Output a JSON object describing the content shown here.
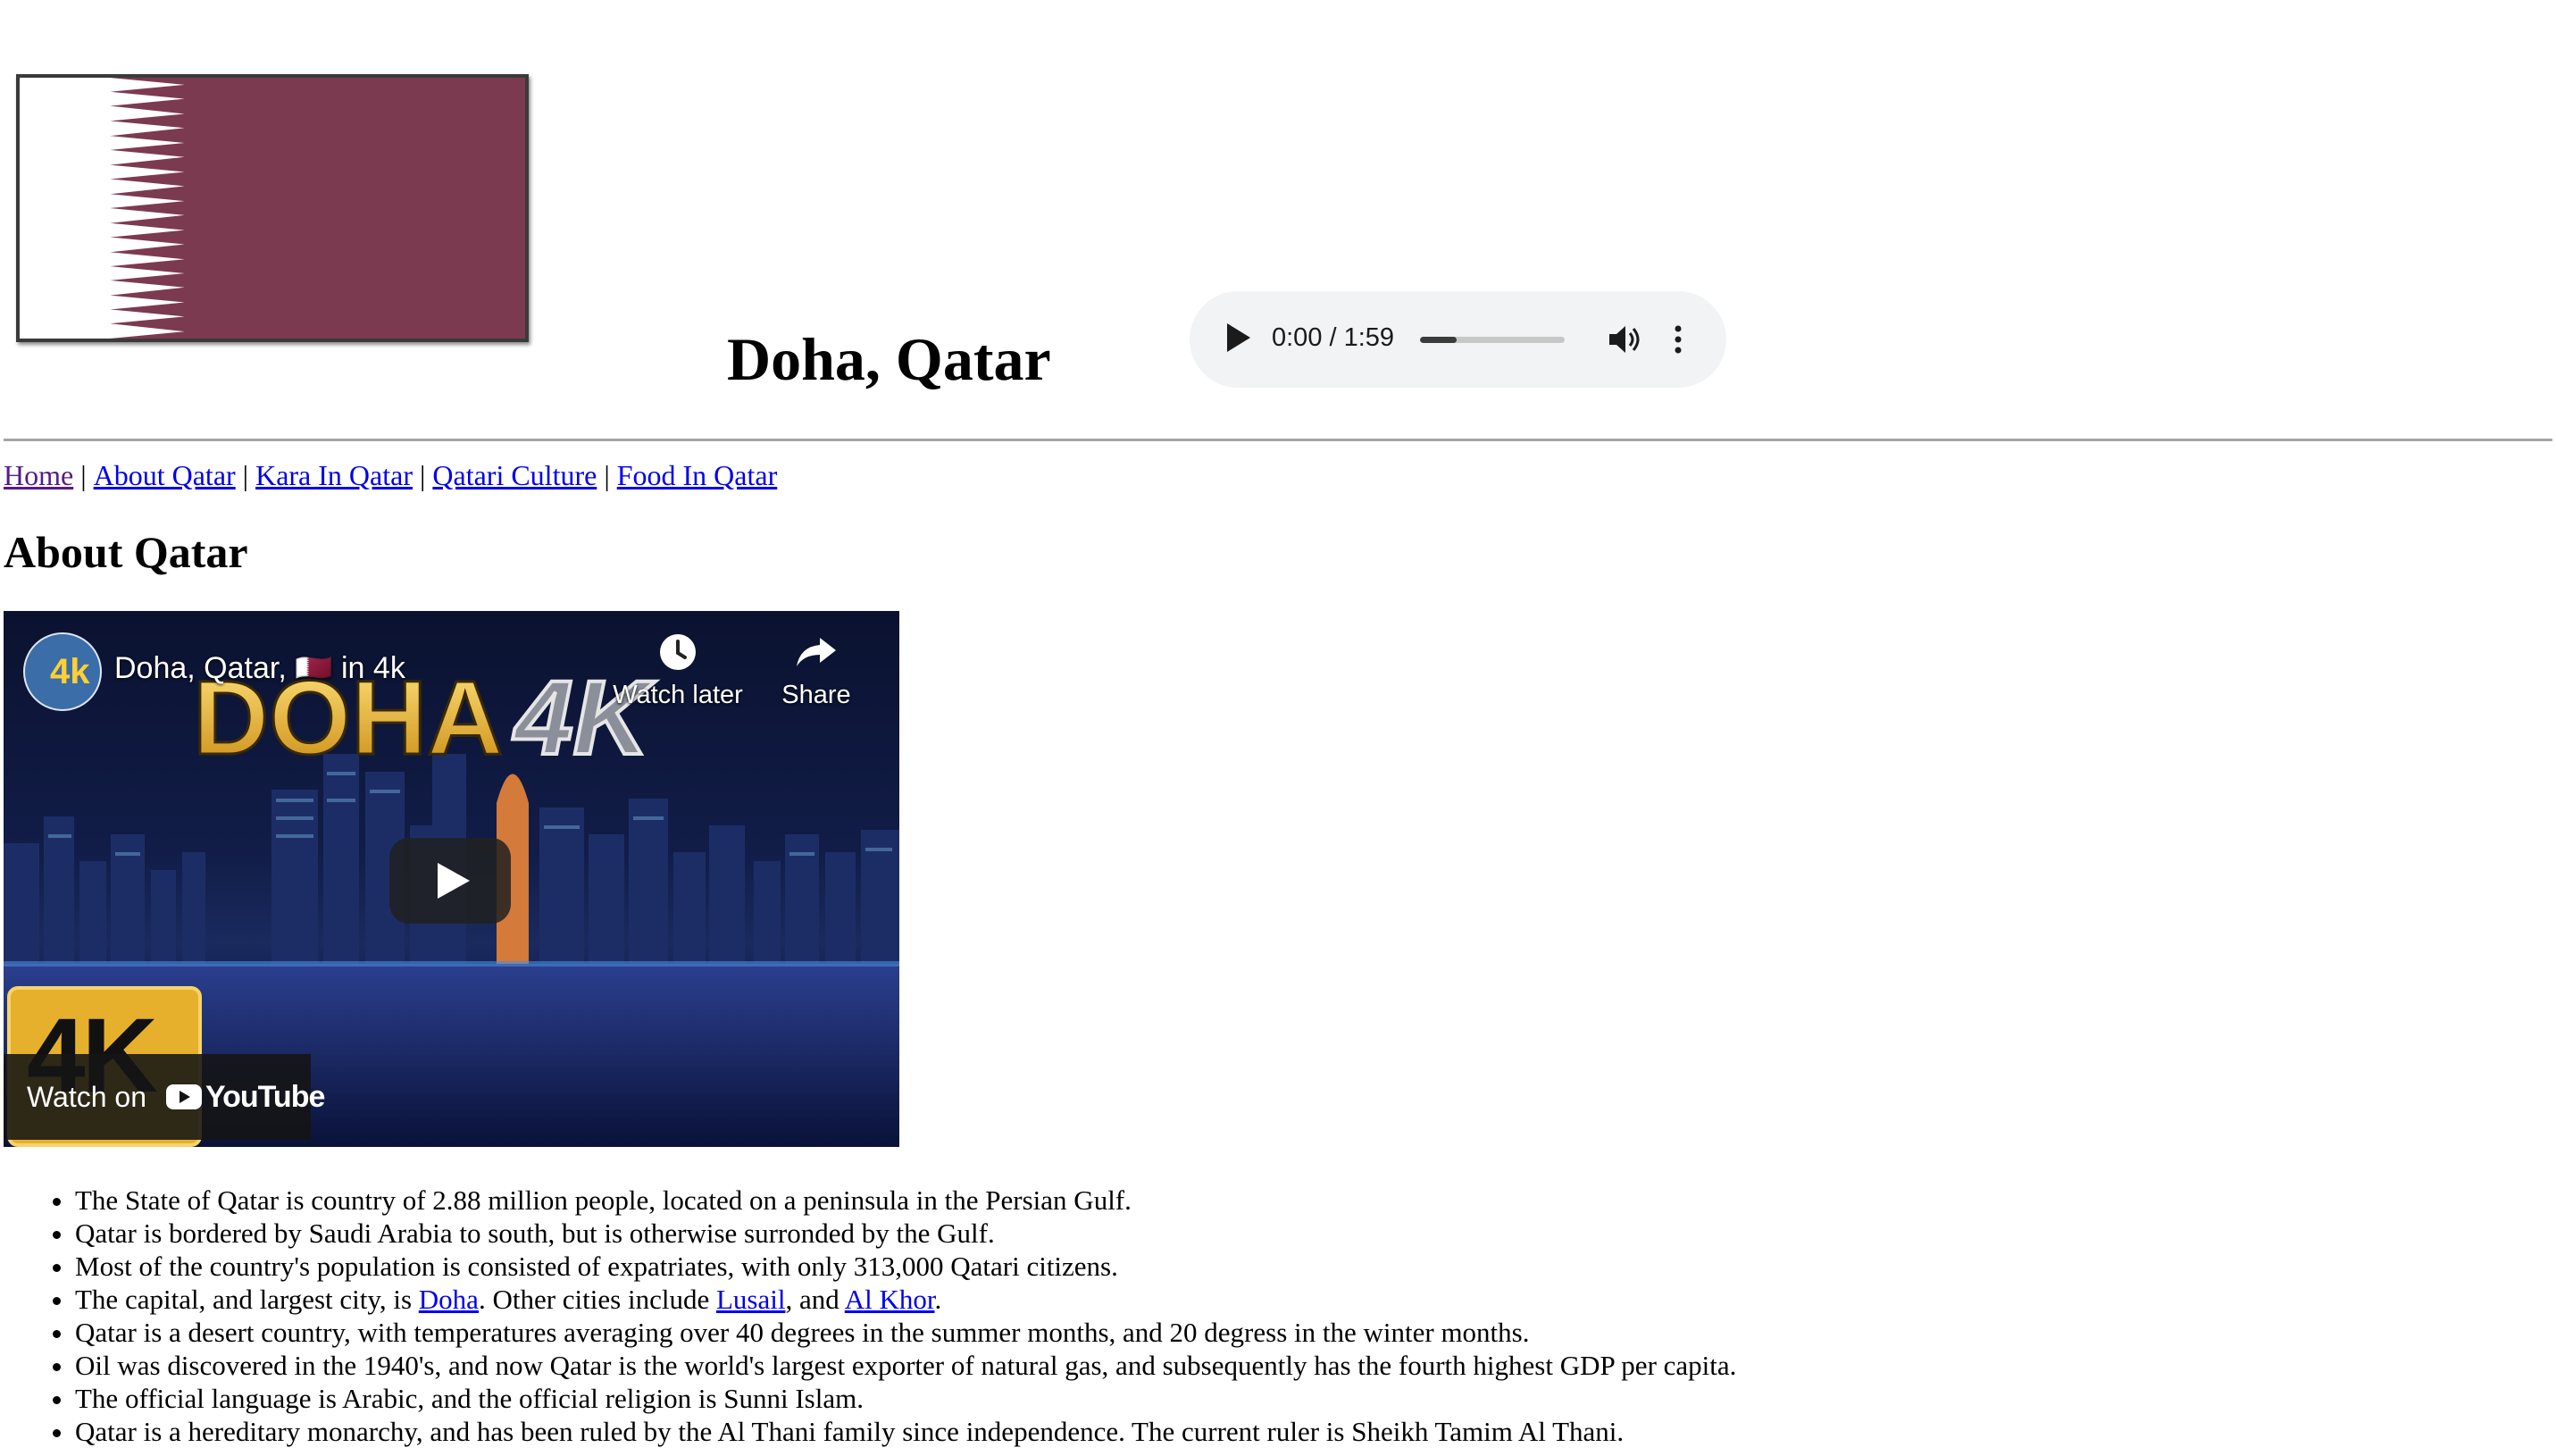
{
  "header": {
    "flag_image": "qatar-flag",
    "title": "Doha, Qatar"
  },
  "audio_player": {
    "time": "0:00 / 1:59",
    "progress": 0.25,
    "icons": [
      "play-icon",
      "volume-icon",
      "more-options-icon"
    ]
  },
  "nav": {
    "items": [
      {
        "label": "Home",
        "visited": true
      },
      {
        "label": "About Qatar"
      },
      {
        "label": "Kara In Qatar"
      },
      {
        "label": "Qatari Culture"
      },
      {
        "label": "Food In Qatar"
      }
    ],
    "separator": "|"
  },
  "section": {
    "title": "About Qatar"
  },
  "video": {
    "channel_avatar_text": "4k",
    "title": "Doha, Qatar, 🇶🇦 in 4k",
    "watch_later_label": "Watch later",
    "share_label": "Share",
    "thumbnail_text": "DOHA",
    "thumbnail_text_2": "4K",
    "badge_text": "4K",
    "watch_on_label": "Watch on",
    "youtube_label": "YouTube"
  },
  "facts": [
    {
      "text": "The State of Qatar is country of 2.88 million people, located on a peninsula in the Persian Gulf."
    },
    {
      "text": "Qatar is bordered by Saudi Arabia to south, but is otherwise surronded by the Gulf."
    },
    {
      "text": "Most of the country's population is consisted of expatriates, with only 313,000 Qatari citizens."
    },
    {
      "parts": {
        "a": "The capital, and largest city, is ",
        "link1": "Doha",
        "b": ". Other cities include ",
        "link2": "Lusail",
        "c": ", and ",
        "link3": "Al Khor",
        "d": "."
      }
    },
    {
      "text": "Qatar is a desert country, with temperatures averaging over 40 degrees in the summer months, and 20 degress in the winter months."
    },
    {
      "text": "Oil was discovered in the 1940's, and now Qatar is the world's largest exporter of natural gas, and subsequently has the fourth highest GDP per capita."
    },
    {
      "text": "The official language is Arabic, and the official religion is Sunni Islam."
    },
    {
      "text": "Qatar is a hereditary monarchy, and has been ruled by the Al Thani family since independence. The current ruler is Sheikh Tamim Al Thani."
    }
  ],
  "colors": {
    "flag_maroon": "#7c3a51",
    "link": "#0000ee",
    "link_visited": "#551a8b",
    "player_bg": "#f1f3f4"
  }
}
